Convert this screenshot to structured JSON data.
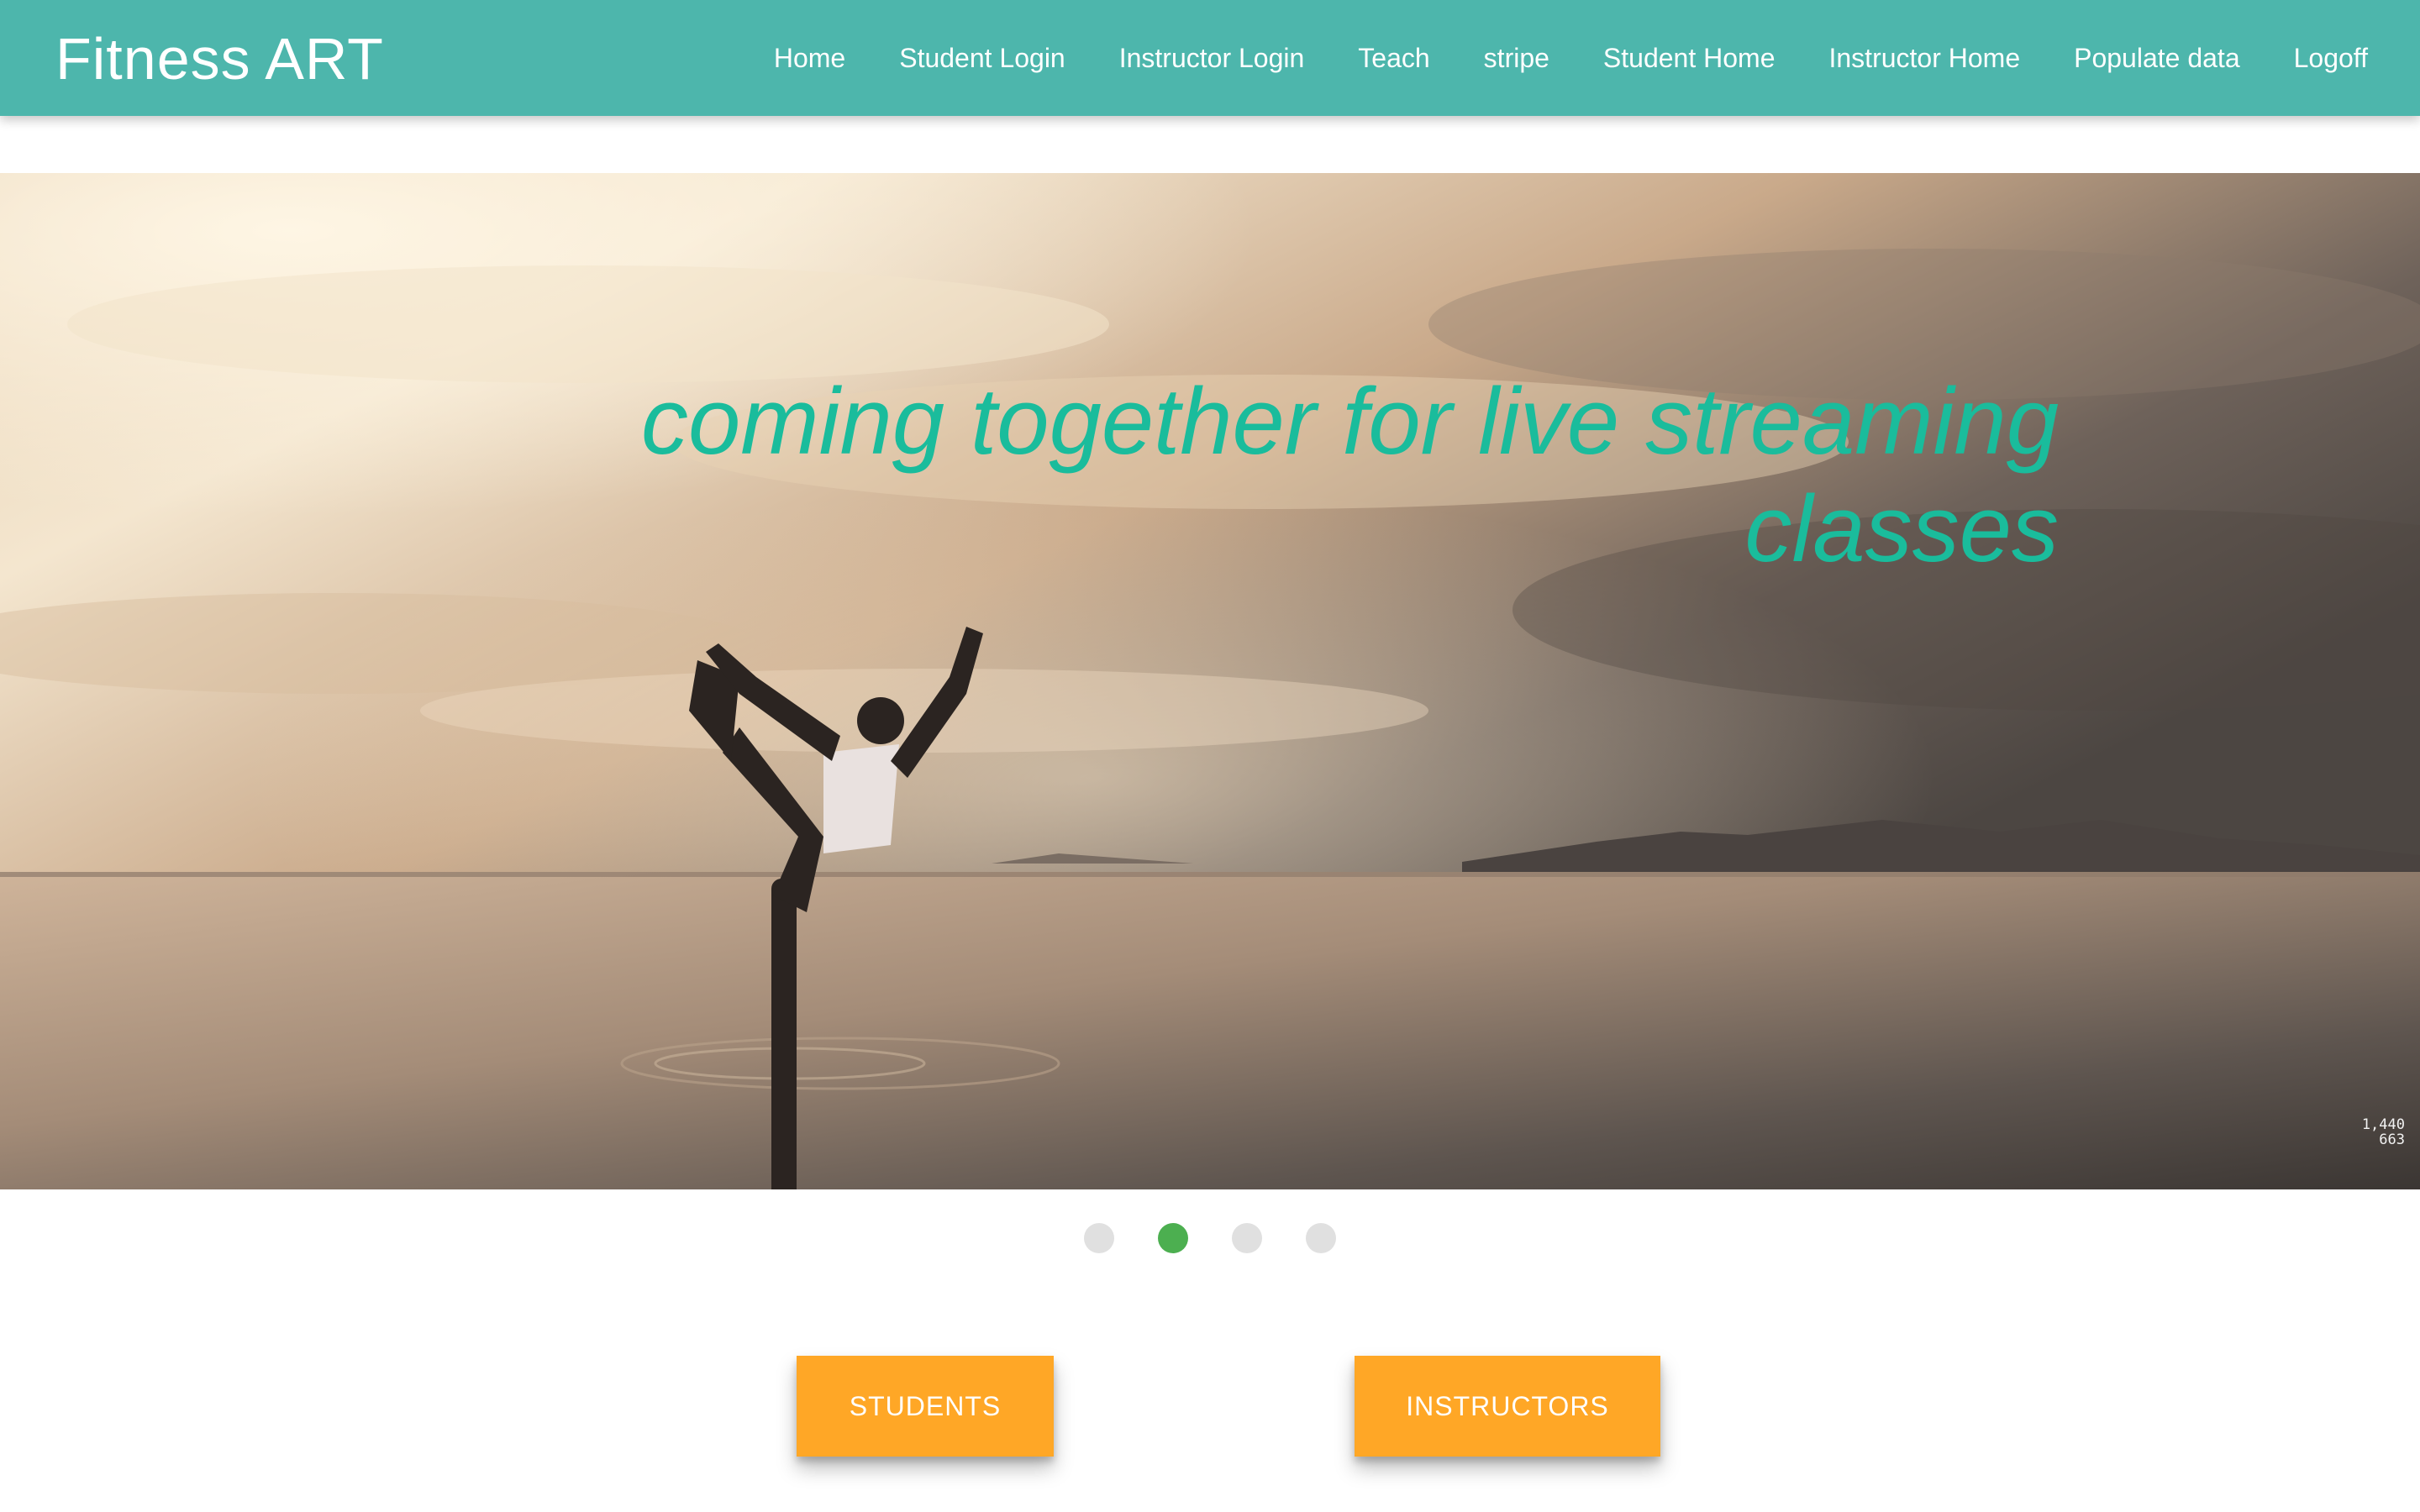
{
  "brand": "Fitness ART",
  "nav": {
    "items": [
      {
        "label": "Home"
      },
      {
        "label": "Student Login"
      },
      {
        "label": "Instructor Login"
      },
      {
        "label": "Teach"
      },
      {
        "label": "stripe"
      },
      {
        "label": "Student Home"
      },
      {
        "label": "Instructor Home"
      },
      {
        "label": "Populate data"
      },
      {
        "label": "Logoff"
      }
    ]
  },
  "hero": {
    "caption_line1": "coming together for live streaming",
    "caption_line2": "classes",
    "caption_color": "#1abc9c",
    "image_dims_line1": "1,440",
    "image_dims_line2": "663",
    "image_subject": "woman in yoga dancer pose standing in water at sunset"
  },
  "carousel": {
    "slide_count": 4,
    "active_index": 1,
    "active_color": "#4caf50",
    "inactive_color": "#e0e0e0"
  },
  "buttons": {
    "students": "STUDENTS",
    "instructors": "INSTRUCTORS",
    "color": "#ffa726"
  },
  "colors": {
    "navbar": "#4db6ac"
  }
}
